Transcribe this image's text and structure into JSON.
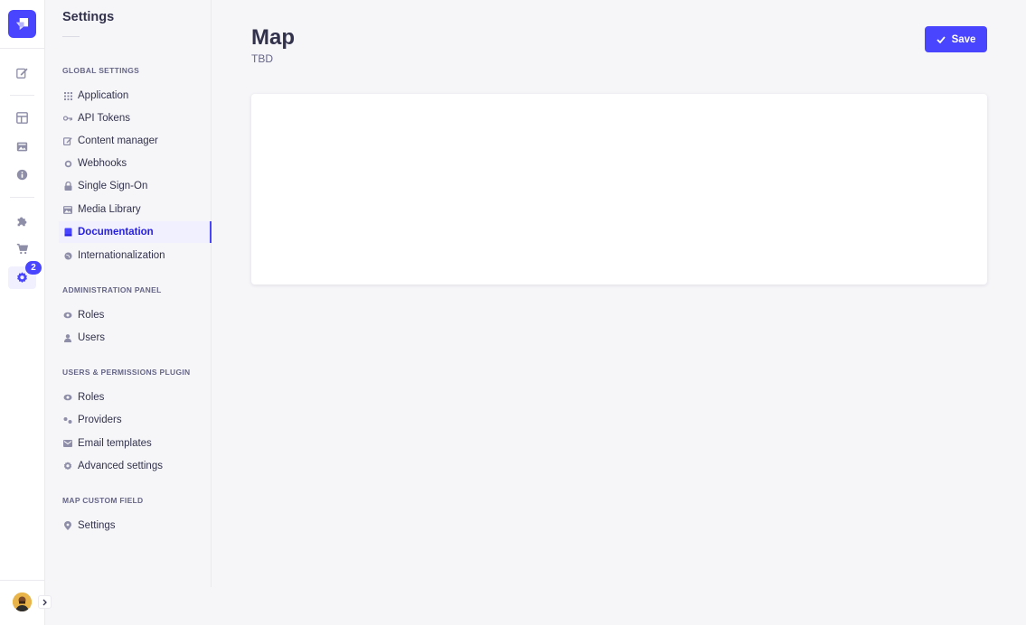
{
  "rail": {
    "badge_count": "2",
    "items": [
      {
        "name": "content-manager-icon"
      },
      {
        "name": "content-type-builder-icon"
      },
      {
        "name": "media-library-icon"
      },
      {
        "name": "info-icon"
      },
      {
        "name": "plugins-icon"
      },
      {
        "name": "marketplace-icon"
      },
      {
        "name": "settings-icon",
        "active": true
      }
    ]
  },
  "subnav": {
    "title": "Settings",
    "sections": [
      {
        "label": "Global Settings",
        "items": [
          {
            "label": "Application",
            "icon": "grid-icon"
          },
          {
            "label": "API Tokens",
            "icon": "key-icon"
          },
          {
            "label": "Content manager",
            "icon": "pencil-icon"
          },
          {
            "label": "Webhooks",
            "icon": "webhook-icon"
          },
          {
            "label": "Single Sign-On",
            "icon": "lock-icon"
          },
          {
            "label": "Media Library",
            "icon": "image-icon"
          },
          {
            "label": "Documentation",
            "icon": "book-icon",
            "active": true
          },
          {
            "label": "Internationalization",
            "icon": "globe-icon"
          }
        ]
      },
      {
        "label": "Administration Panel",
        "items": [
          {
            "label": "Roles",
            "icon": "eye-icon"
          },
          {
            "label": "Users",
            "icon": "user-icon"
          }
        ]
      },
      {
        "label": "Users & Permissions Plugin",
        "items": [
          {
            "label": "Roles",
            "icon": "eye-icon"
          },
          {
            "label": "Providers",
            "icon": "providers-icon"
          },
          {
            "label": "Email templates",
            "icon": "envelope-icon"
          },
          {
            "label": "Advanced settings",
            "icon": "gear-icon"
          }
        ]
      },
      {
        "label": "Map Custom Field",
        "items": [
          {
            "label": "Settings",
            "icon": "pin-icon"
          }
        ]
      }
    ]
  },
  "header": {
    "title": "Map",
    "subtitle": "TBD",
    "save_label": "Save"
  },
  "colors": {
    "accent": "#4945ff",
    "background": "#f6f6f9",
    "text": "#32324d",
    "muted": "#666687"
  }
}
